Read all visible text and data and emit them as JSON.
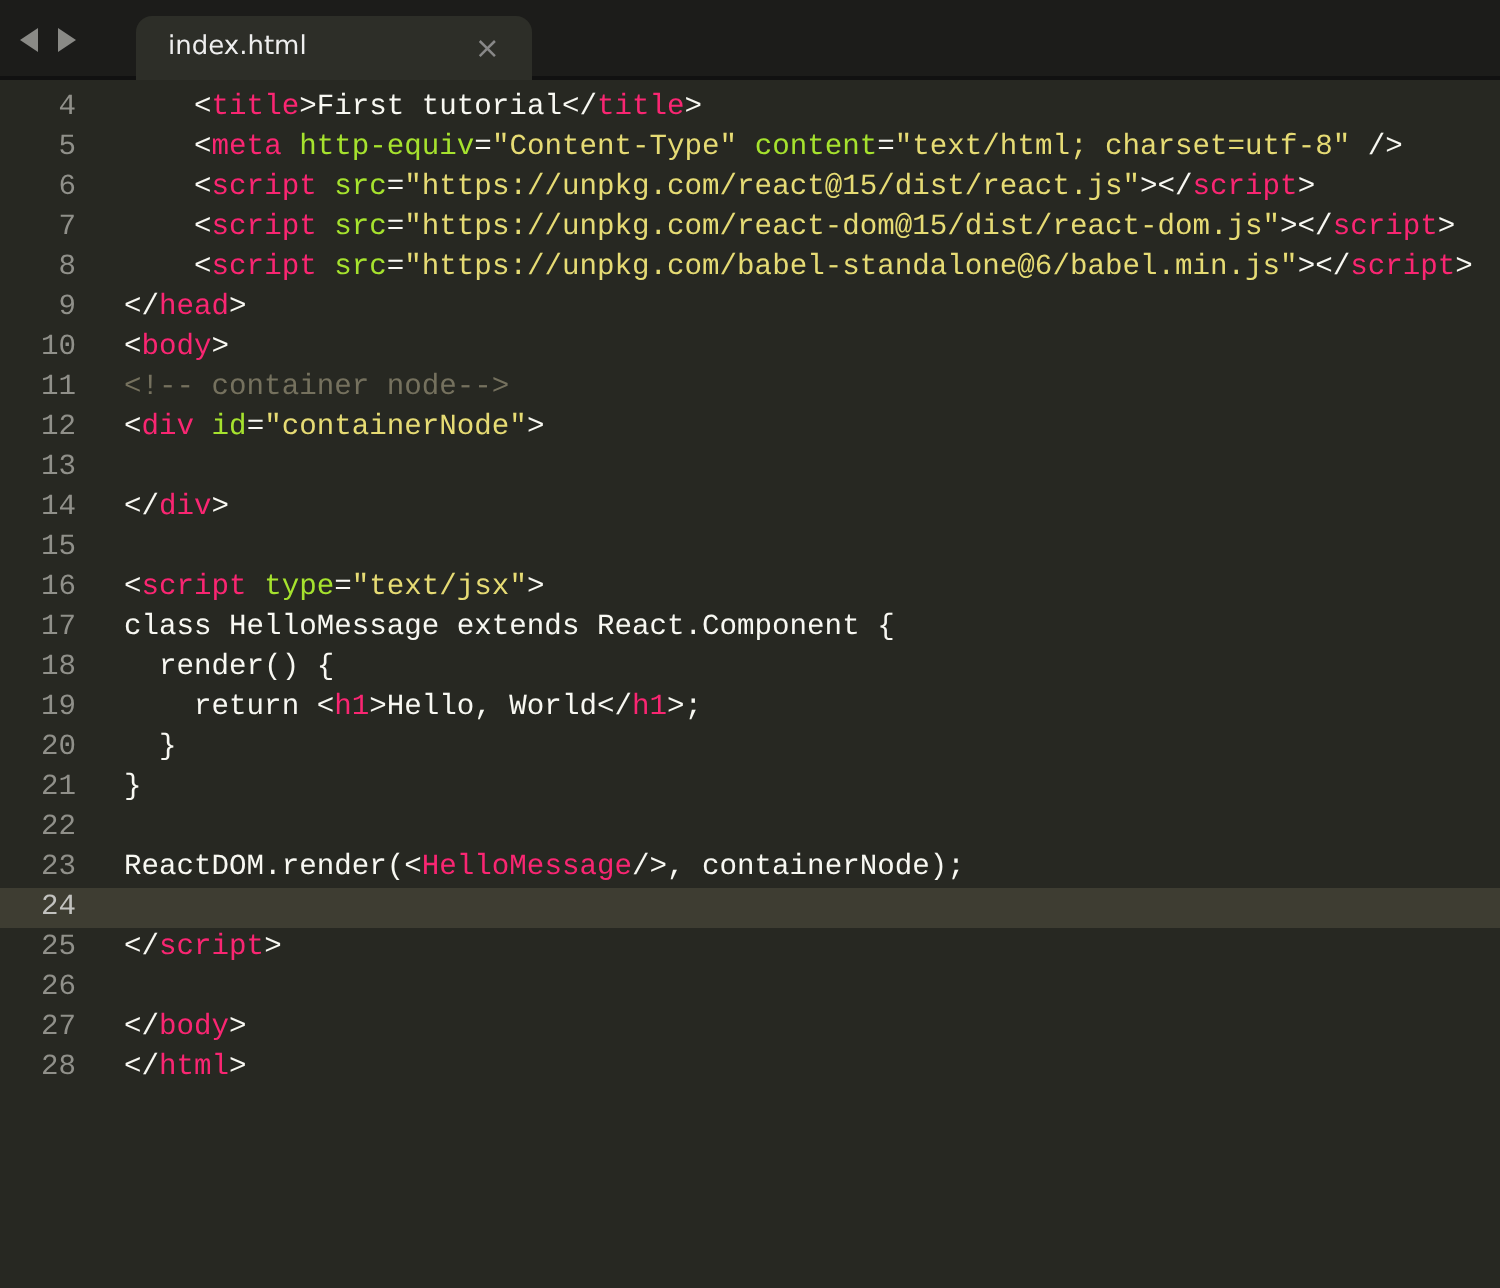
{
  "tabs": [
    {
      "label": "index.html",
      "selected": true,
      "close": "×"
    }
  ],
  "lines": [
    {
      "number": "4",
      "current": false,
      "tokens": [
        {
          "kind": "plain",
          "text": "    <"
        },
        {
          "kind": "tag",
          "text": "title"
        },
        {
          "kind": "plain",
          "text": ">First tutorial</"
        },
        {
          "kind": "tag",
          "text": "title"
        },
        {
          "kind": "plain",
          "text": ">"
        }
      ]
    },
    {
      "number": "5",
      "current": false,
      "tokens": [
        {
          "kind": "plain",
          "text": "    <"
        },
        {
          "kind": "tag",
          "text": "meta "
        },
        {
          "kind": "attr",
          "text": "http-equiv"
        },
        {
          "kind": "plain",
          "text": "="
        },
        {
          "kind": "string",
          "text": "\"Content-Type\" "
        },
        {
          "kind": "attr",
          "text": "content"
        },
        {
          "kind": "plain",
          "text": "="
        },
        {
          "kind": "string",
          "text": "\"text/html; charset=utf-8\""
        },
        {
          "kind": "plain",
          "text": " />"
        }
      ]
    },
    {
      "number": "6",
      "current": false,
      "tokens": [
        {
          "kind": "plain",
          "text": "    <"
        },
        {
          "kind": "tag",
          "text": "script "
        },
        {
          "kind": "attr",
          "text": "src"
        },
        {
          "kind": "plain",
          "text": "="
        },
        {
          "kind": "string",
          "text": "\"https://unpkg.com/react@15/dist/react.js\""
        },
        {
          "kind": "plain",
          "text": "></"
        },
        {
          "kind": "tag",
          "text": "script"
        },
        {
          "kind": "plain",
          "text": ">"
        }
      ]
    },
    {
      "number": "7",
      "current": false,
      "tokens": [
        {
          "kind": "plain",
          "text": "    <"
        },
        {
          "kind": "tag",
          "text": "script "
        },
        {
          "kind": "attr",
          "text": "src"
        },
        {
          "kind": "plain",
          "text": "="
        },
        {
          "kind": "string",
          "text": "\"https://unpkg.com/react-dom@15/dist/react-dom.js\""
        },
        {
          "kind": "plain",
          "text": "></"
        },
        {
          "kind": "tag",
          "text": "script"
        },
        {
          "kind": "plain",
          "text": ">"
        }
      ]
    },
    {
      "number": "8",
      "current": false,
      "tokens": [
        {
          "kind": "plain",
          "text": "    <"
        },
        {
          "kind": "tag",
          "text": "script "
        },
        {
          "kind": "attr",
          "text": "src"
        },
        {
          "kind": "plain",
          "text": "="
        },
        {
          "kind": "string",
          "text": "\"https://unpkg.com/babel-standalone@6/babel.min.js\""
        },
        {
          "kind": "plain",
          "text": "></"
        },
        {
          "kind": "tag",
          "text": "script"
        },
        {
          "kind": "plain",
          "text": ">"
        }
      ]
    },
    {
      "number": "9",
      "current": false,
      "tokens": [
        {
          "kind": "plain",
          "text": "</"
        },
        {
          "kind": "tag",
          "text": "head"
        },
        {
          "kind": "plain",
          "text": ">"
        }
      ]
    },
    {
      "number": "10",
      "current": false,
      "tokens": [
        {
          "kind": "plain",
          "text": "<"
        },
        {
          "kind": "tag",
          "text": "body"
        },
        {
          "kind": "plain",
          "text": ">"
        }
      ]
    },
    {
      "number": "11",
      "current": false,
      "tokens": [
        {
          "kind": "comment",
          "text": "<!-- container node-->"
        }
      ]
    },
    {
      "number": "12",
      "current": false,
      "tokens": [
        {
          "kind": "plain",
          "text": "<"
        },
        {
          "kind": "tag",
          "text": "div "
        },
        {
          "kind": "attr",
          "text": "id"
        },
        {
          "kind": "plain",
          "text": "="
        },
        {
          "kind": "string",
          "text": "\"containerNode\""
        },
        {
          "kind": "plain",
          "text": ">"
        }
      ]
    },
    {
      "number": "13",
      "current": false
    },
    {
      "number": "14",
      "current": false,
      "tokens": [
        {
          "kind": "plain",
          "text": "</"
        },
        {
          "kind": "tag",
          "text": "div"
        },
        {
          "kind": "plain",
          "text": ">"
        }
      ]
    },
    {
      "number": "15",
      "current": false
    },
    {
      "number": "16",
      "current": false,
      "tokens": [
        {
          "kind": "plain",
          "text": "<"
        },
        {
          "kind": "tag",
          "text": "script "
        },
        {
          "kind": "attr",
          "text": "type"
        },
        {
          "kind": "plain",
          "text": "="
        },
        {
          "kind": "string",
          "text": "\"text/jsx\""
        },
        {
          "kind": "plain",
          "text": ">"
        }
      ]
    },
    {
      "number": "17",
      "current": false,
      "tokens": [
        {
          "kind": "plain",
          "text": "class HelloMessage extends React.Component {"
        }
      ]
    },
    {
      "number": "18",
      "current": false,
      "tokens": [
        {
          "kind": "plain",
          "text": "  render() {"
        }
      ]
    },
    {
      "number": "19",
      "current": false,
      "tokens": [
        {
          "kind": "plain",
          "text": "    return <"
        },
        {
          "kind": "tag",
          "text": "h1"
        },
        {
          "kind": "plain",
          "text": ">Hello, World</"
        },
        {
          "kind": "tag",
          "text": "h1"
        },
        {
          "kind": "plain",
          "text": ">;"
        }
      ]
    },
    {
      "number": "20",
      "current": false,
      "tokens": [
        {
          "kind": "plain",
          "text": "  }"
        }
      ]
    },
    {
      "number": "21",
      "current": false,
      "tokens": [
        {
          "kind": "plain",
          "text": "}"
        }
      ]
    },
    {
      "number": "22",
      "current": false
    },
    {
      "number": "23",
      "current": false,
      "tokens": [
        {
          "kind": "plain",
          "text": "ReactDOM.render(<"
        },
        {
          "kind": "tag",
          "text": "HelloMessage"
        },
        {
          "kind": "plain",
          "text": "/>, containerNode);"
        }
      ]
    },
    {
      "number": "24",
      "current": true
    },
    {
      "number": "25",
      "current": false,
      "tokens": [
        {
          "kind": "plain",
          "text": "</"
        },
        {
          "kind": "tag",
          "text": "script"
        },
        {
          "kind": "plain",
          "text": ">"
        }
      ]
    },
    {
      "number": "26",
      "current": false
    },
    {
      "number": "27",
      "current": false,
      "tokens": [
        {
          "kind": "plain",
          "text": "</"
        },
        {
          "kind": "tag",
          "text": "body"
        },
        {
          "kind": "plain",
          "text": ">"
        }
      ]
    },
    {
      "number": "28",
      "current": false,
      "tokens": [
        {
          "kind": "plain",
          "text": "</"
        },
        {
          "kind": "tag",
          "text": "html"
        },
        {
          "kind": "plain",
          "text": ">"
        }
      ]
    }
  ]
}
